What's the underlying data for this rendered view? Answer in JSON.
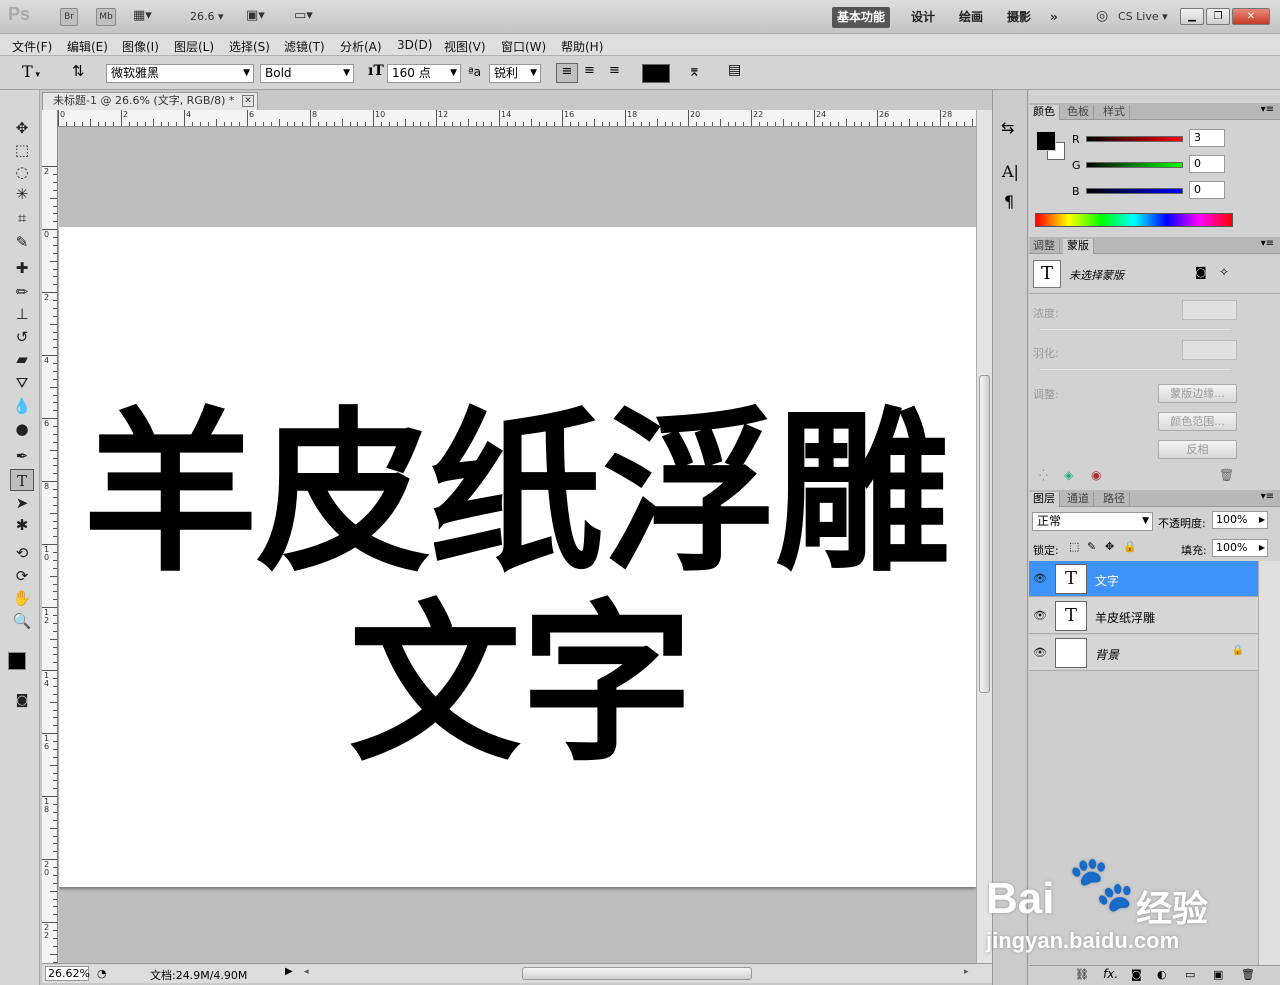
{
  "app": {
    "logo": "Ps",
    "bridge_btn": "Br",
    "minibridge_btn": "Mb",
    "zoom_value": "26.6",
    "workspaces": [
      "基本功能",
      "设计",
      "绘画",
      "摄影"
    ],
    "more": "»",
    "cslive": "CS Live"
  },
  "menu": [
    "文件(F)",
    "编辑(E)",
    "图像(I)",
    "图层(L)",
    "选择(S)",
    "滤镜(T)",
    "分析(A)",
    "3D(D)",
    "视图(V)",
    "窗口(W)",
    "帮助(H)"
  ],
  "options": {
    "tool_glyph": "T",
    "font_family": "微软雅黑",
    "font_style": "Bold",
    "font_size": "160 点",
    "aa_label": "ªa",
    "aa_mode": "锐利",
    "color": "#000000"
  },
  "document": {
    "tab_title": "未标题-1 @ 26.6% (文字, RGB/8) *",
    "hruler_labels": [
      "0",
      "2",
      "4",
      "6",
      "8",
      "10",
      "12",
      "14",
      "16",
      "18",
      "20",
      "22",
      "24",
      "26",
      "28"
    ],
    "vruler_labels": [
      "2",
      "0",
      "2",
      "4",
      "6",
      "8",
      "1\n0",
      "1\n2",
      "1\n4",
      "1\n6",
      "1\n8",
      "2\n0",
      "2\n2"
    ],
    "line1": "羊皮纸浮雕",
    "line2": "文字",
    "text_color": "#000000",
    "canvas_color": "#ffffff"
  },
  "status": {
    "zoom": "26.62%",
    "docinfo": "文档:24.9M/4.90M"
  },
  "color_panel": {
    "tabs": [
      "颜色",
      "色板",
      "样式"
    ],
    "r_label": "R",
    "g_label": "G",
    "b_label": "B",
    "r": "3",
    "g": "0",
    "b": "0"
  },
  "masks_panel": {
    "tabs": [
      "调整",
      "蒙版"
    ],
    "title": "未选择蒙版",
    "density": "浓度:",
    "feather": "羽化:",
    "refine": "调整:",
    "btn_mask_edge": "蒙版边缘...",
    "btn_color_range": "颜色范围...",
    "btn_invert": "反相"
  },
  "layers_panel": {
    "tabs": [
      "图层",
      "通道",
      "路径"
    ],
    "blend_mode": "正常",
    "opacity_label": "不透明度:",
    "opacity": "100%",
    "lock_label": "锁定:",
    "fill_label": "填充:",
    "fill": "100%",
    "layers": [
      {
        "name": "文字",
        "thumb": "T",
        "selected": true
      },
      {
        "name": "羊皮纸浮雕",
        "thumb": "T",
        "selected": false
      },
      {
        "name": "背景",
        "thumb": "",
        "selected": false
      }
    ]
  },
  "watermark": {
    "brand": "Bai",
    "brand2": "经验",
    "url": "jingyan.baidu.com"
  }
}
